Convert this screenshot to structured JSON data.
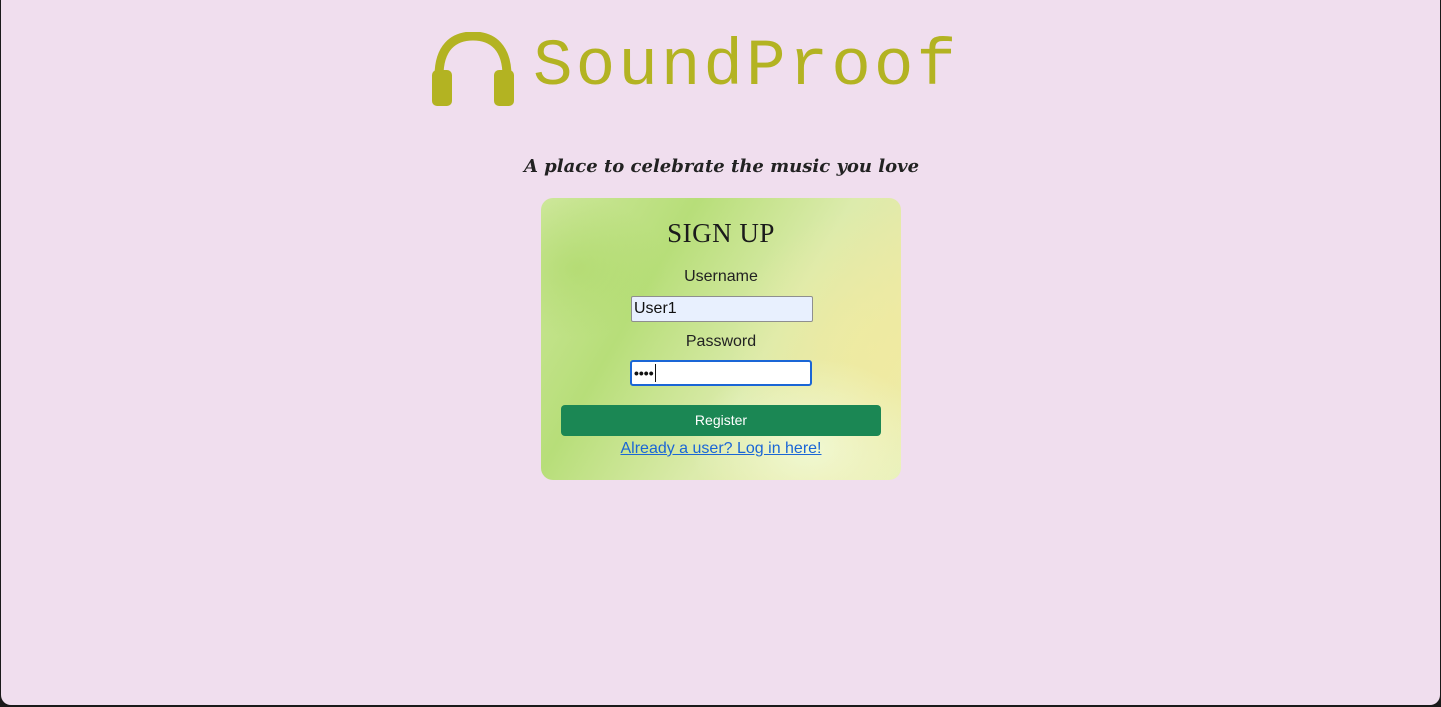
{
  "brand": {
    "name": "SoundProof",
    "logo_icon": "headphones-icon",
    "color": "#b3b322"
  },
  "tagline": "A place to celebrate the music you love",
  "signup": {
    "title": "SIGN UP",
    "username_label": "Username",
    "username_value": "User1",
    "password_label": "Password",
    "password_value": "••••",
    "register_label": "Register",
    "register_color": "#1b8754",
    "login_link": "Already a user? Log in here!"
  },
  "colors": {
    "background": "#f0deee",
    "link": "#1a66d6"
  }
}
